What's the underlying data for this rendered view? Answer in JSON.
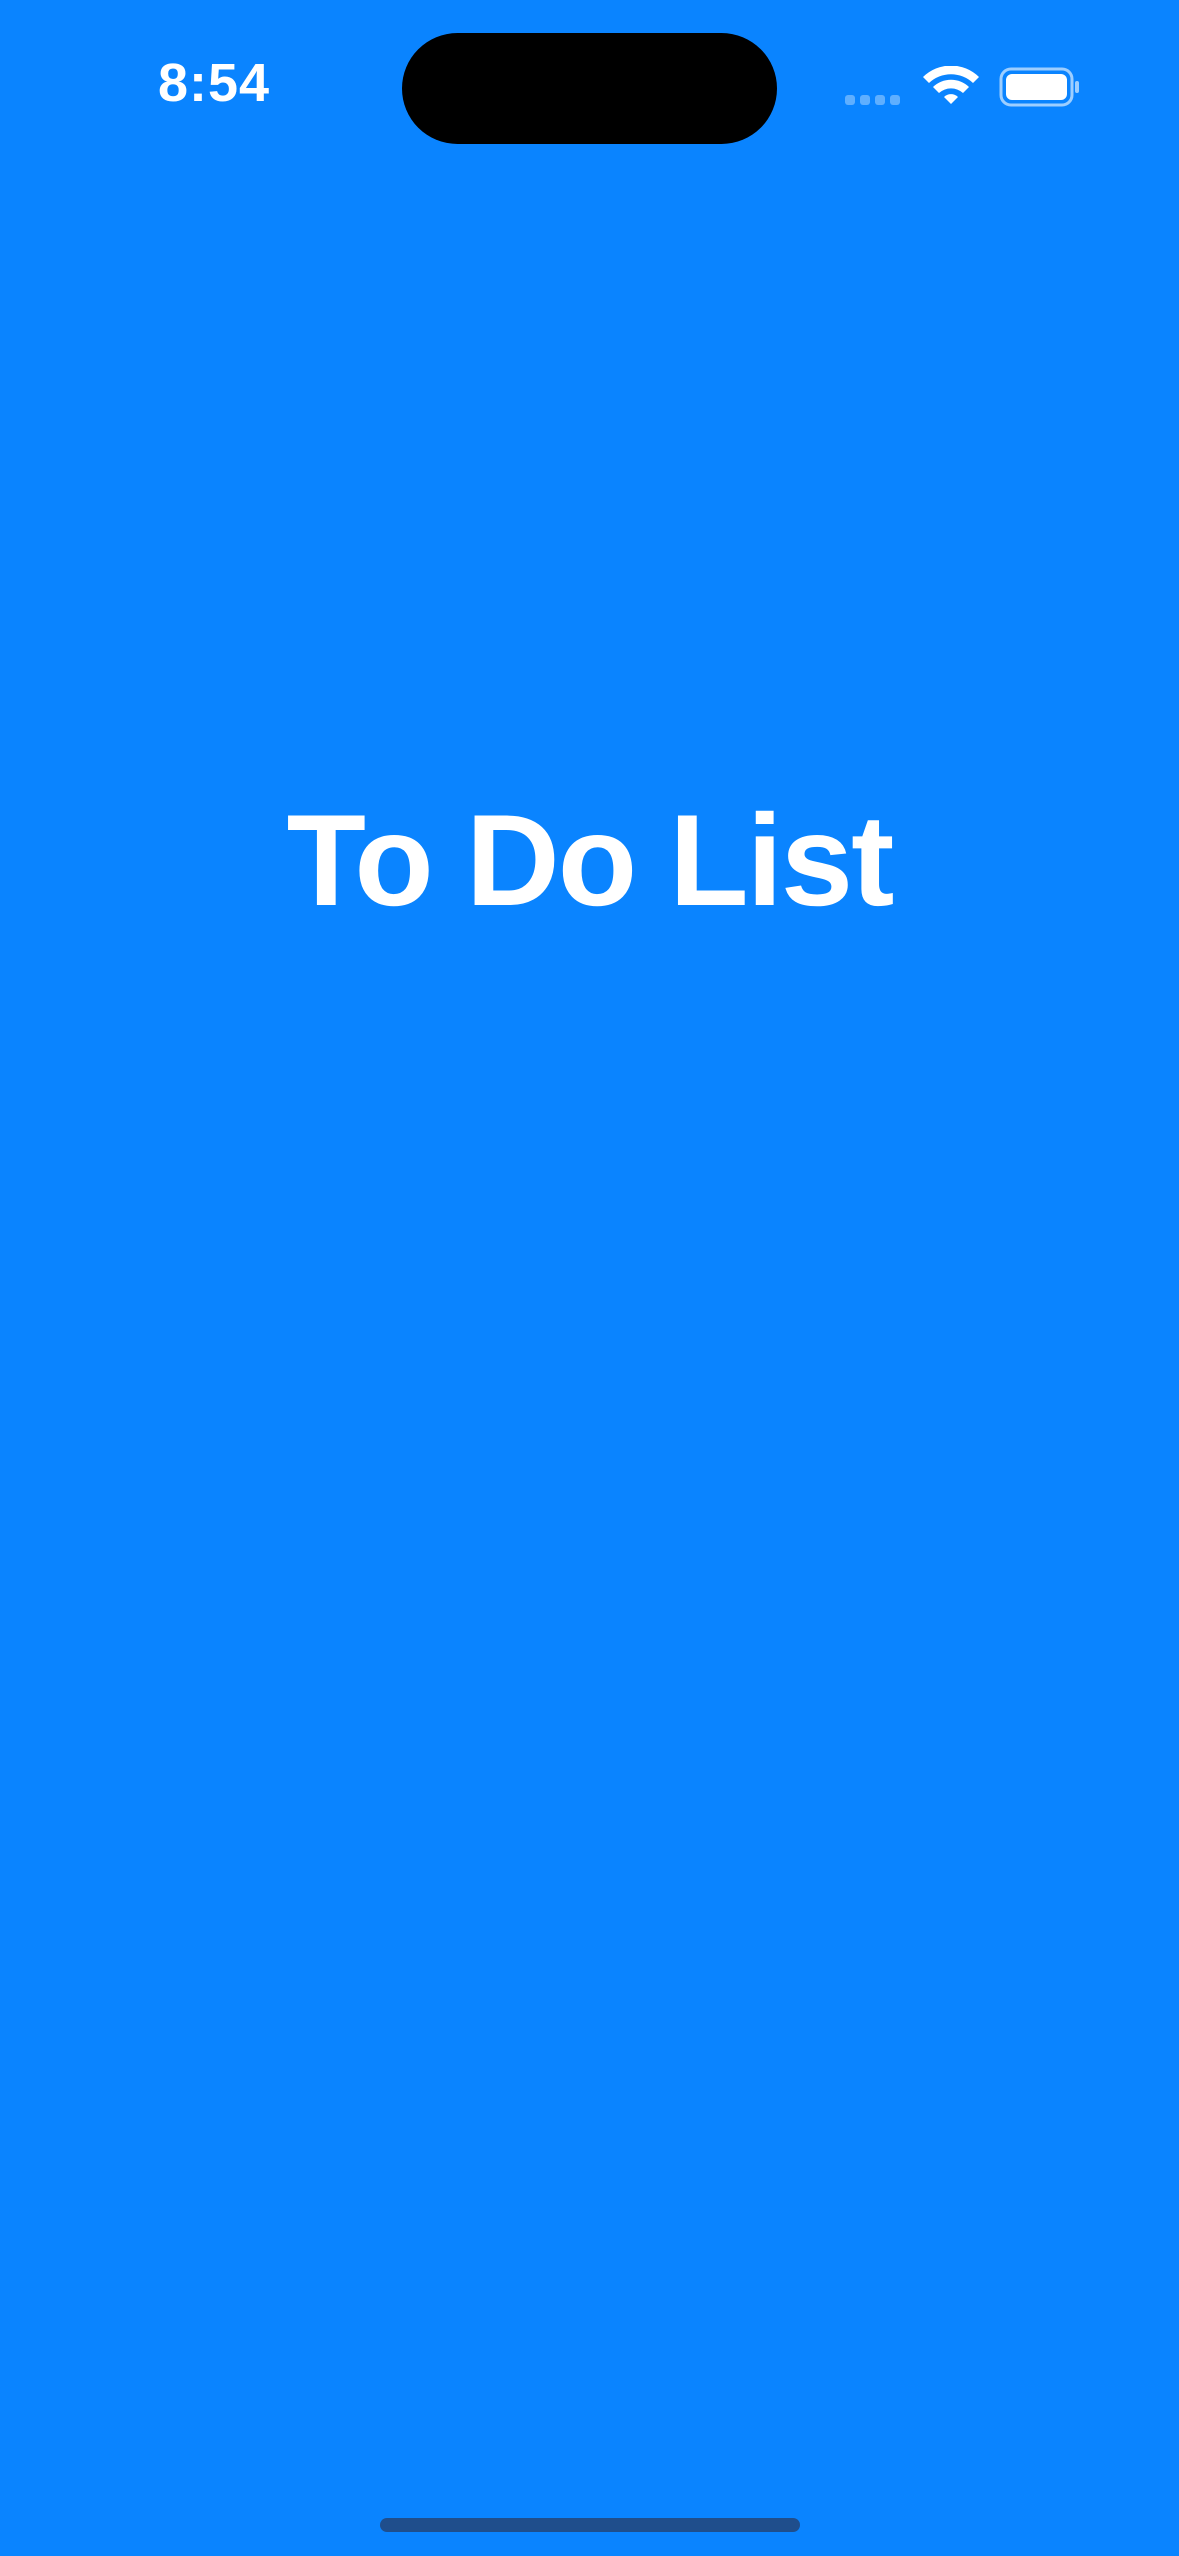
{
  "status_bar": {
    "time": "8:54",
    "signal_icon": "cellular-signal-icon",
    "wifi_icon": "wifi-icon",
    "battery_icon": "battery-icon"
  },
  "main": {
    "title": "To Do List"
  },
  "colors": {
    "background": "#0A84FF",
    "text": "#FFFFFF",
    "home_indicator": "#1F4E8C"
  }
}
